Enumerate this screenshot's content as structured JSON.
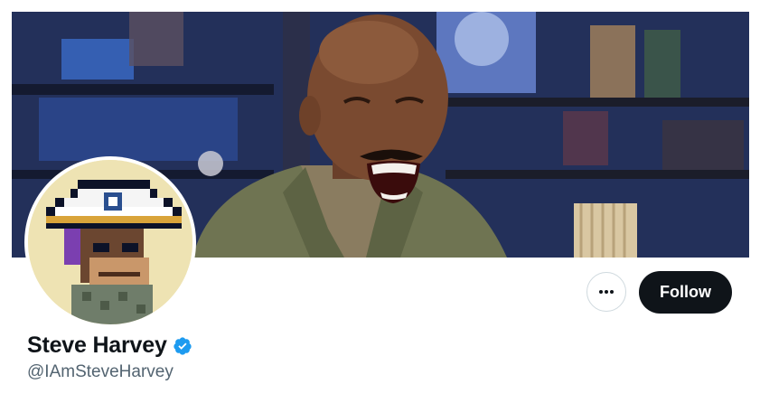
{
  "profile": {
    "name": "Steve Harvey",
    "handle": "@IAmSteveHarvey",
    "verified": true
  },
  "actions": {
    "follow_label": "Follow",
    "more_icon": "more-horizontal-icon"
  },
  "images": {
    "banner": "banner-photo",
    "avatar": "pixel-art-ape-captain-hat-avatar"
  },
  "colors": {
    "verified_badge": "#1d9bf0",
    "follow_button_bg": "#0f1419",
    "handle_text": "#536471"
  }
}
